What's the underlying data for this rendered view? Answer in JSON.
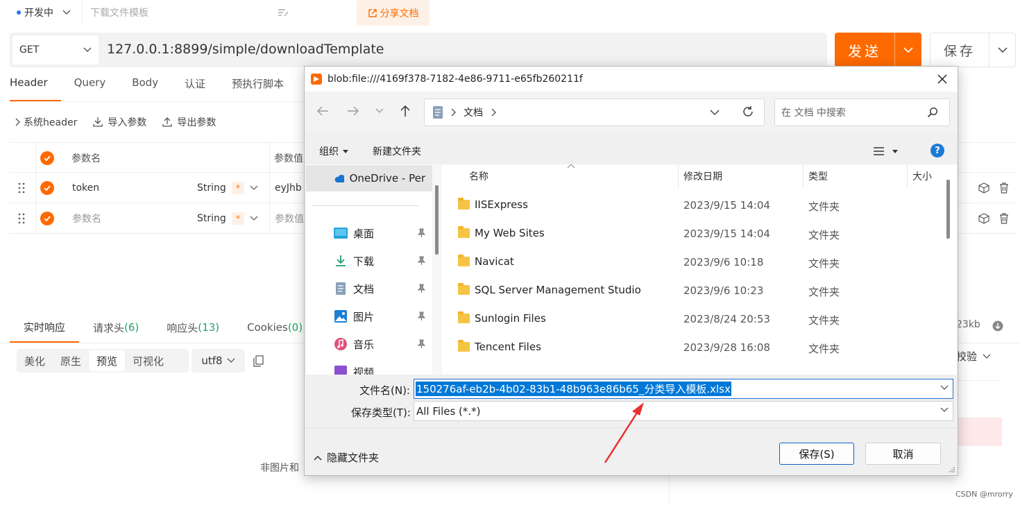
{
  "app": {
    "status_label": "开发中",
    "description_placeholder": "下载文件模板",
    "share_label": "分享文档",
    "method": "GET",
    "url": "127.0.0.1:8899/simple/downloadTemplate",
    "send_label": "发送",
    "save_label": "保存",
    "request_tabs": [
      "Header",
      "Query",
      "Body",
      "认证",
      "预执行脚本"
    ],
    "param_tools": {
      "system_header": "系统header",
      "import": "导入参数",
      "export": "导出参数"
    },
    "param_table": {
      "col_name": "参数名",
      "col_value": "参数值",
      "rows": [
        {
          "name": "token",
          "type": "String",
          "required": "*",
          "value": "eyJhb"
        },
        {
          "name": "参数名",
          "type": "String",
          "required": "*",
          "value": "参数值"
        }
      ]
    },
    "response_tabs": [
      {
        "label": "实时响应",
        "count": ""
      },
      {
        "label": "请求头",
        "count": "(6)"
      },
      {
        "label": "响应头",
        "count": "(13)"
      },
      {
        "label": "Cookies",
        "count": "(0)"
      }
    ],
    "view_modes": [
      "美化",
      "原生",
      "预览",
      "可视化"
    ],
    "active_view": "预览",
    "encoding": "utf8",
    "size_text": "23kb",
    "verify_label": "校验",
    "non_image_text": "非图片和",
    "watermark": "CSDN @mrorry"
  },
  "dialog": {
    "title": "blob:file:///4169f378-7182-4e86-9711-e65fb260211f",
    "breadcrumb": "文档",
    "search_placeholder": "在 文档 中搜索",
    "organize_label": "组织",
    "new_folder_label": "新建文件夹",
    "help_label": "?",
    "nav_items": [
      {
        "label": "OneDrive - Per",
        "icon": "cloud-icon"
      },
      {
        "label": "桌面",
        "icon": "desktop-icon"
      },
      {
        "label": "下载",
        "icon": "download-icon"
      },
      {
        "label": "文档",
        "icon": "document-icon"
      },
      {
        "label": "图片",
        "icon": "picture-icon"
      },
      {
        "label": "音乐",
        "icon": "music-icon"
      },
      {
        "label": "视频",
        "icon": "video-icon"
      }
    ],
    "columns": {
      "name": "名称",
      "modified": "修改日期",
      "type": "类型",
      "size": "大小"
    },
    "files": [
      {
        "name": "IISExpress",
        "modified": "2023/9/15 14:04",
        "type": "文件夹"
      },
      {
        "name": "My Web Sites",
        "modified": "2023/9/15 14:04",
        "type": "文件夹"
      },
      {
        "name": "Navicat",
        "modified": "2023/9/6 10:18",
        "type": "文件夹"
      },
      {
        "name": "SQL Server Management Studio",
        "modified": "2023/9/6 10:23",
        "type": "文件夹"
      },
      {
        "name": "Sunlogin Files",
        "modified": "2023/8/24 20:53",
        "type": "文件夹"
      },
      {
        "name": "Tencent Files",
        "modified": "2023/9/28 16:08",
        "type": "文件夹"
      }
    ],
    "filename_label": "文件名(N):",
    "filename_value": "150276af-eb2b-4b02-83b1-48b963e86b65_分类导入模板.xlsx",
    "filetype_label": "保存类型(T):",
    "filetype_value": "All Files (*.*)",
    "hide_folders_label": "隐藏文件夹",
    "save_button": "保存(S)",
    "cancel_button": "取消"
  },
  "colors": {
    "accent": "#ff6a00",
    "selection": "#0078d7",
    "annotation_arrow": "#e8312f"
  }
}
